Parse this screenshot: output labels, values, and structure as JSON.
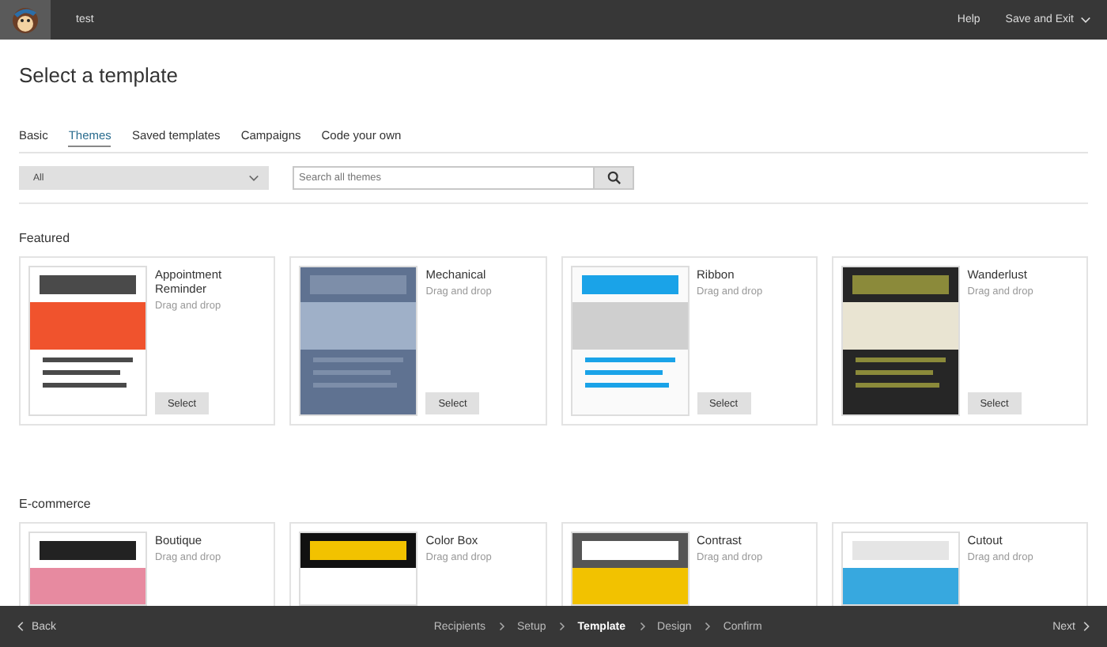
{
  "top_bar": {
    "campaign": "test",
    "help": "Help",
    "save_exit": "Save and Exit"
  },
  "title": "Select a template",
  "tabs": [
    {
      "label": "Basic",
      "selected": false
    },
    {
      "label": "Themes",
      "selected": true
    },
    {
      "label": "Saved templates",
      "selected": false
    },
    {
      "label": "Campaigns",
      "selected": false
    },
    {
      "label": "Code your own",
      "selected": false
    }
  ],
  "filter": {
    "value": "All"
  },
  "search": {
    "placeholder": "Search all themes"
  },
  "sections": [
    {
      "heading": "Featured",
      "cards": [
        {
          "name": "Appointment Reminder",
          "subtitle": "Drag and drop",
          "kind": "orange",
          "button": "Select"
        },
        {
          "name": "Mechanical",
          "subtitle": "Drag and drop",
          "kind": "slate",
          "button": "Select"
        },
        {
          "name": "Ribbon",
          "subtitle": "Drag and drop",
          "kind": "ribbon",
          "button": "Select"
        },
        {
          "name": "Wanderlust",
          "subtitle": "Drag and drop",
          "kind": "dark",
          "button": "Select"
        }
      ]
    },
    {
      "heading": "E-commerce",
      "cards": [
        {
          "name": "Boutique",
          "subtitle": "Drag and drop",
          "kind": "pink"
        },
        {
          "name": "Color Box",
          "subtitle": "Drag and drop",
          "kind": "black"
        },
        {
          "name": "Contrast",
          "subtitle": "Drag and drop",
          "kind": "grey"
        },
        {
          "name": "Cutout",
          "subtitle": "Drag and drop",
          "kind": "white"
        }
      ]
    }
  ],
  "footer": {
    "back": "Back",
    "next": "Next",
    "steps": [
      {
        "label": "Recipients",
        "selected": false
      },
      {
        "label": "Setup",
        "selected": false
      },
      {
        "label": "Template",
        "selected": true
      },
      {
        "label": "Design",
        "selected": false
      },
      {
        "label": "Confirm",
        "selected": false
      }
    ]
  }
}
